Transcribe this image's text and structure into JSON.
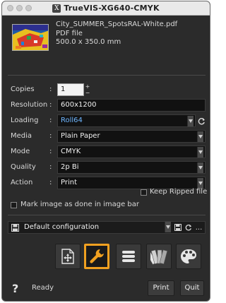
{
  "window": {
    "title": "TrueVIS-XG640-CMYK"
  },
  "file": {
    "name": "City_SUMMER_SpotsRAL-White.pdf",
    "type": "PDF file",
    "size": "500.0 x 350.0 mm"
  },
  "form": {
    "copies": {
      "label": "Copies",
      "value": "1"
    },
    "resolution": {
      "label": "Resolution",
      "value": "600x1200"
    },
    "loading": {
      "label": "Loading",
      "value": "Roll64"
    },
    "media": {
      "label": "Media",
      "value": "Plain Paper"
    },
    "mode": {
      "label": "Mode",
      "value": "CMYK"
    },
    "quality": {
      "label": "Quality",
      "value": "2p Bi"
    },
    "action": {
      "label": "Action",
      "value": "Print"
    },
    "colon": ":"
  },
  "options": {
    "keep_ripped": {
      "label": "Keep Ripped file",
      "checked": false
    },
    "mark_image": {
      "label": "Mark image as done in image bar",
      "checked": false
    }
  },
  "config": {
    "value": "Default configuration",
    "more_label": "..."
  },
  "toolbar": {
    "active_tool": "wrench",
    "tools": [
      "layout-icon",
      "wrench-icon",
      "list-icon",
      "color-swatches-icon",
      "palette-icon"
    ],
    "accent_color": "#f0a020"
  },
  "footer": {
    "help": "?",
    "status": "Ready",
    "print_label": "Print",
    "quit_label": "Quit"
  }
}
